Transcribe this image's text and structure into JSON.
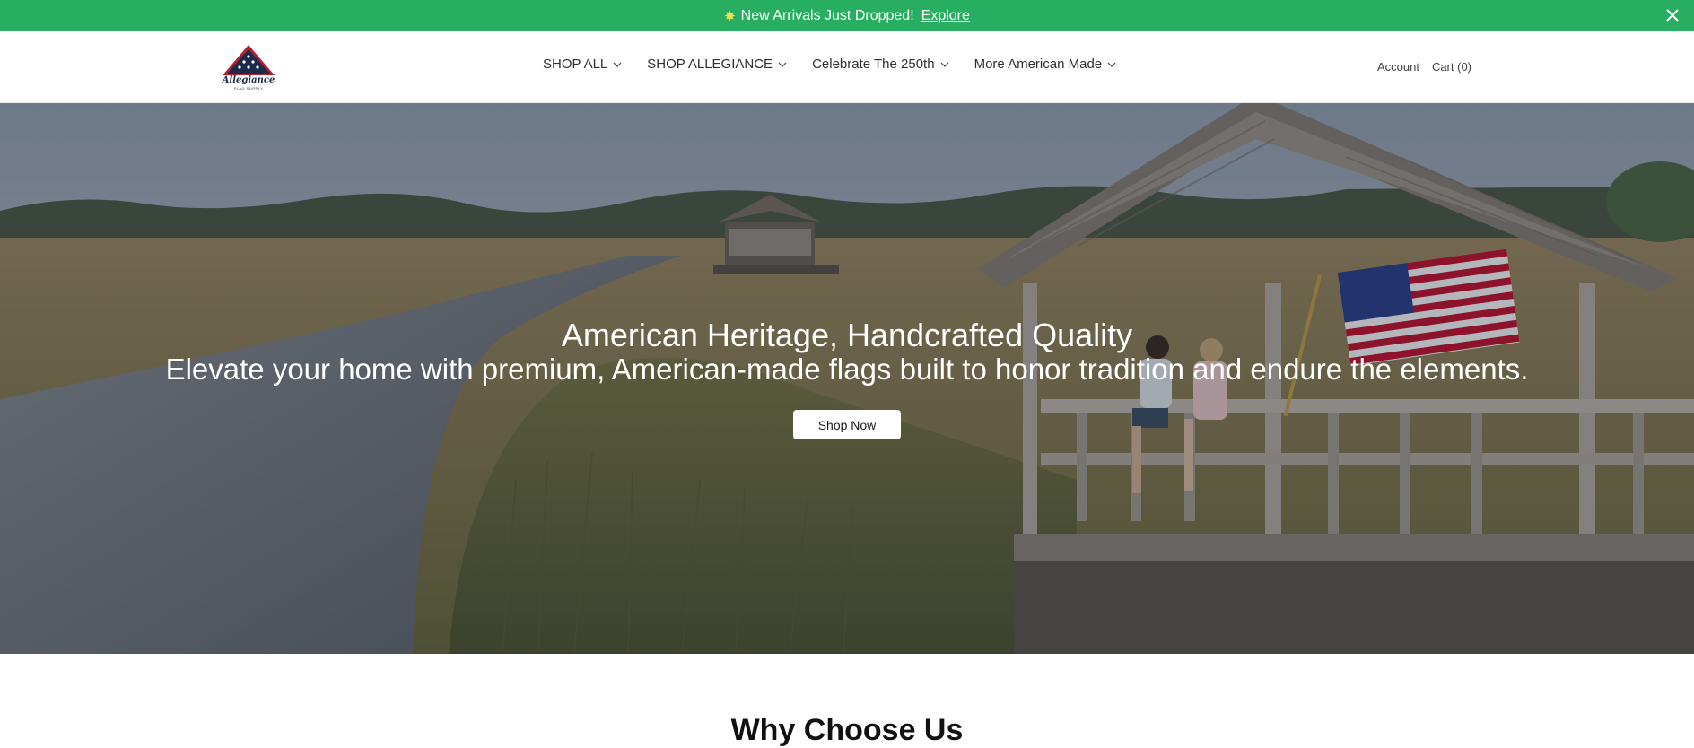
{
  "announcement": {
    "icon": "sparkle-star-icon",
    "text": "New Arrivals Just Dropped!",
    "link_label": "Explore"
  },
  "header": {
    "logo_text": "Allegiance",
    "logo_subtext": "FLAG SUPPLY",
    "nav": [
      {
        "label": "SHOP ALL"
      },
      {
        "label": "SHOP ALLEGIANCE"
      },
      {
        "label": "Celebrate The 250th"
      },
      {
        "label": "More American Made"
      }
    ],
    "account_label": "Account",
    "cart_label": "Cart (0)"
  },
  "hero": {
    "title": "American Heritage, Handcrafted Quality",
    "subtitle": "Elevate your home with premium, American-made flags built to honor tradition and endure the elements.",
    "button_label": "Shop Now"
  },
  "section": {
    "heading": "Why Choose Us"
  },
  "colors": {
    "announcement_bg": "#27ae60",
    "logo_navy": "#1e2a4a",
    "logo_red": "#b22234"
  }
}
